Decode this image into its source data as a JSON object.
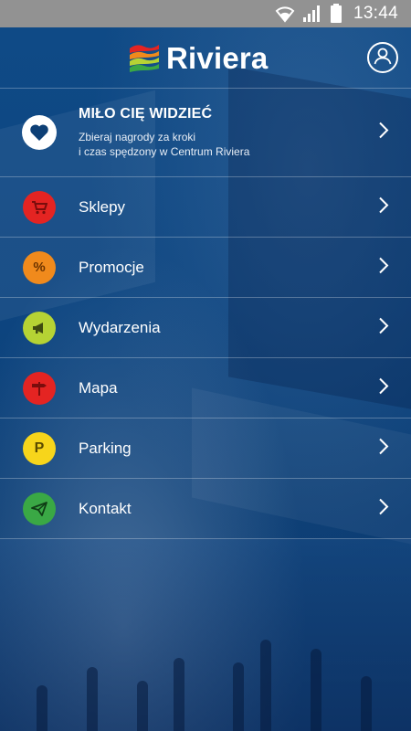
{
  "status_bar": {
    "time": "13:44",
    "icons": [
      "wifi-icon",
      "signal-icon",
      "battery-icon"
    ]
  },
  "header": {
    "logo_text": "Riviera",
    "profile_icon": "user-icon"
  },
  "welcome": {
    "title": "MIŁO CIĘ WIDZIEĆ",
    "subtitle": "Zbieraj nagrody za kroki\ni czas spędzony w Centrum Riviera",
    "icon": "heart-icon"
  },
  "menu": [
    {
      "label": "Sklepy",
      "icon": "cart-icon",
      "color": "#e42422"
    },
    {
      "label": "Promocje",
      "icon": "percent-icon",
      "color": "#f08a1c"
    },
    {
      "label": "Wydarzenia",
      "icon": "megaphone-icon",
      "color": "#b6d334"
    },
    {
      "label": "Mapa",
      "icon": "signpost-icon",
      "color": "#e42422"
    },
    {
      "label": "Parking",
      "icon": "parking-icon",
      "color": "#f7d51b"
    },
    {
      "label": "Kontakt",
      "icon": "paper-plane-icon",
      "color": "#3aa845"
    }
  ]
}
